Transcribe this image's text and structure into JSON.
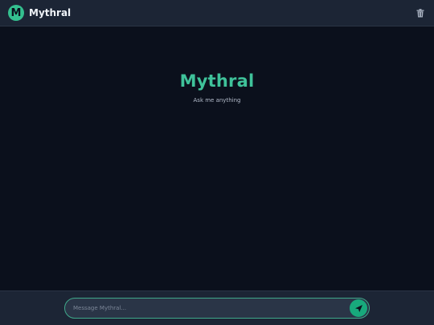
{
  "header": {
    "logo_letter": "M",
    "title": "Mythral",
    "delete_icon": "trash-icon"
  },
  "welcome": {
    "title": "Mythral",
    "subtitle": "Ask me anything"
  },
  "composer": {
    "placeholder": "Message Mythral...",
    "value": "",
    "send_icon": "send-icon"
  },
  "colors": {
    "background": "#0b101c",
    "header_bg": "#1c2535",
    "accent": "#3fc29a",
    "send_button": "#18a97c"
  }
}
